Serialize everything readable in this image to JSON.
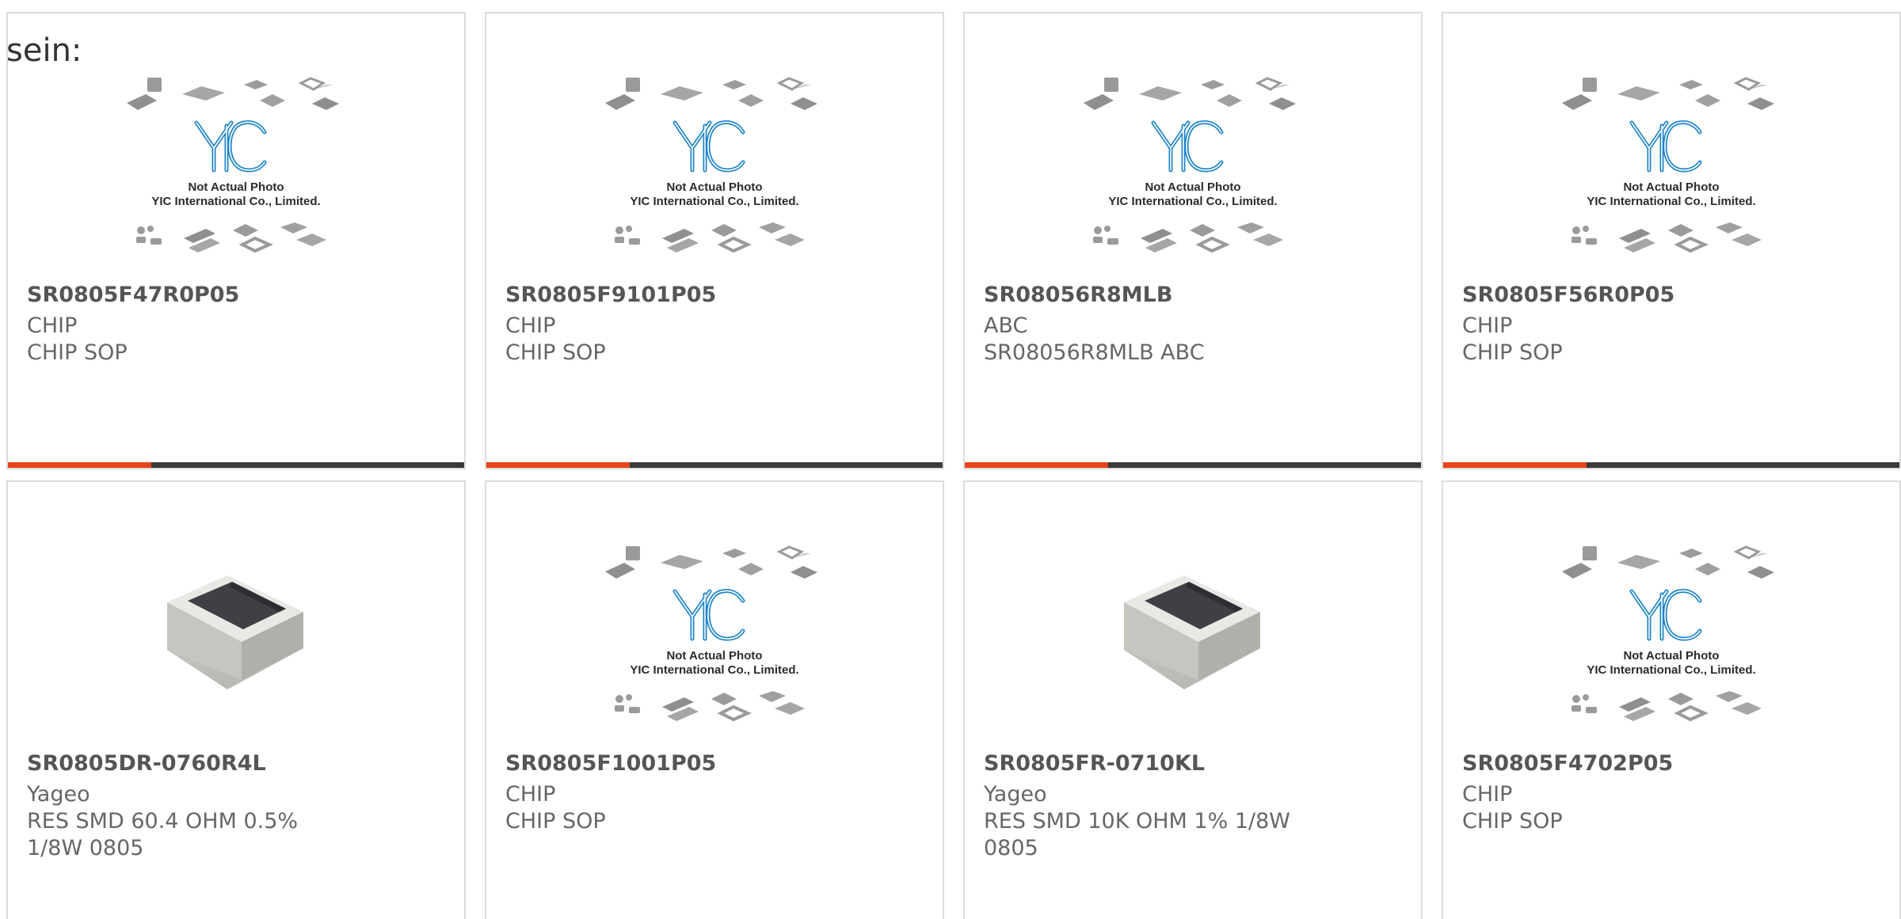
{
  "intro_text": "sein:",
  "colors": {
    "accent": "#e8431a",
    "bar_dark": "#3a3a3a",
    "card_border": "#dcdcdc",
    "logo_blue": "#1e84c9"
  },
  "placeholder_caption": {
    "line1": "Not Actual Photo",
    "line2": "YIC International Co., Limited."
  },
  "products": [
    {
      "part_number": "SR0805F47R0P05",
      "manufacturer": "CHIP",
      "description": "CHIP SOP",
      "image": "placeholder",
      "icon": "yic-logo-icon"
    },
    {
      "part_number": "SR0805F9101P05",
      "manufacturer": "CHIP",
      "description": "CHIP SOP",
      "image": "placeholder",
      "icon": "yic-logo-icon"
    },
    {
      "part_number": "SR08056R8MLB",
      "manufacturer": "ABC",
      "description": "SR08056R8MLB ABC",
      "image": "placeholder",
      "icon": "yic-logo-icon"
    },
    {
      "part_number": "SR0805F56R0P05",
      "manufacturer": "CHIP",
      "description": "CHIP SOP",
      "image": "placeholder",
      "icon": "yic-logo-icon"
    },
    {
      "part_number": "SR0805DR-0760R4L",
      "manufacturer": "Yageo",
      "description": "RES SMD 60.4 OHM 0.5% 1/8W 0805",
      "image": "resistor",
      "icon": "smd-resistor-icon"
    },
    {
      "part_number": "SR0805F1001P05",
      "manufacturer": "CHIP",
      "description": "CHIP SOP",
      "image": "placeholder",
      "icon": "yic-logo-icon"
    },
    {
      "part_number": "SR0805FR-0710KL",
      "manufacturer": "Yageo",
      "description": "RES SMD 10K OHM 1% 1/8W 0805",
      "image": "resistor",
      "icon": "smd-resistor-icon"
    },
    {
      "part_number": "SR0805F4702P05",
      "manufacturer": "CHIP",
      "description": "CHIP SOP",
      "image": "placeholder",
      "icon": "yic-logo-icon"
    }
  ]
}
